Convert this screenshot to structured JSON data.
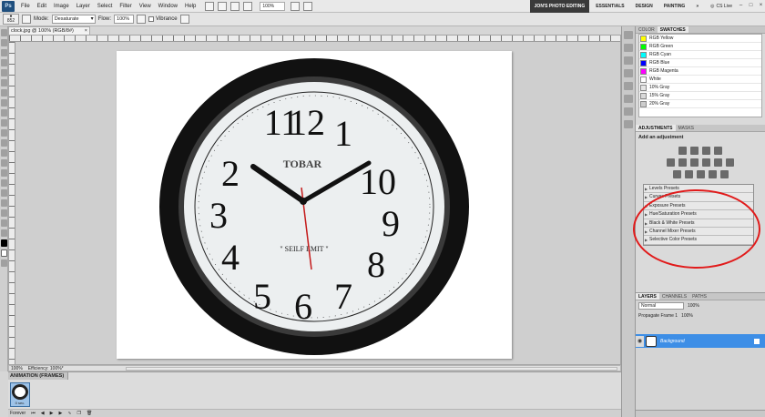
{
  "menubar": {
    "logo": "Ps",
    "items": [
      "File",
      "Edit",
      "Image",
      "Layer",
      "Select",
      "Filter",
      "View",
      "Window",
      "Help"
    ],
    "zoom": "100%",
    "workspaces": [
      "JON'S PHOTO EDITING",
      "ESSENTIALS",
      "DESIGN",
      "PAINTING"
    ],
    "active_workspace": "JON'S PHOTO EDITING",
    "more": "»",
    "cs_live": "CS Live",
    "window_controls": [
      "–",
      "□",
      "×"
    ]
  },
  "options": {
    "brush_size": "852",
    "mode_label": "Mode:",
    "mode_value": "Desaturate",
    "flow_label": "Flow:",
    "flow_value": "100%",
    "vibrance_label": "Vibrance"
  },
  "document": {
    "tab_title": "clock.jpg @ 100% (RGB/8#)",
    "close": "×",
    "zoom_status": "100%",
    "efficiency": "Efficiency: 100%*"
  },
  "clock": {
    "brand": "TOBAR",
    "tagline": "\" SEILF EMIT \"",
    "numbers": [
      "12",
      "1",
      "2",
      "3",
      "4",
      "5",
      "6",
      "7",
      "8",
      "9",
      "10",
      "11"
    ]
  },
  "animation": {
    "title": "ANIMATION (FRAMES)",
    "frame_delay": "0 sec.",
    "loop": "Forever"
  },
  "swatches": {
    "tabs": [
      "COLOR",
      "SWATCHES"
    ],
    "active_tab": "SWATCHES",
    "items": [
      {
        "name": "RGB Yellow",
        "color": "#ffff00"
      },
      {
        "name": "RGB Green",
        "color": "#00ff00"
      },
      {
        "name": "RGB Cyan",
        "color": "#00ffff"
      },
      {
        "name": "RGB Blue",
        "color": "#0000ff"
      },
      {
        "name": "RGB Magenta",
        "color": "#ff00ff"
      },
      {
        "name": "White",
        "color": "#ffffff"
      },
      {
        "name": "10% Gray",
        "color": "#e6e6e6"
      },
      {
        "name": "15% Gray",
        "color": "#d9d9d9"
      },
      {
        "name": "20% Gray",
        "color": "#cccccc"
      }
    ]
  },
  "adjustments": {
    "tabs": [
      "ADJUSTMENTS",
      "MASKS"
    ],
    "title": "Add an adjustment",
    "presets": [
      "Levels Presets",
      "Curves Presets",
      "Exposure Presets",
      "Hue/Saturation Presets",
      "Black & White Presets",
      "Channel Mixer Presets",
      "Selective Color Presets"
    ]
  },
  "layers": {
    "tabs": [
      "LAYERS",
      "CHANNELS",
      "PATHS"
    ],
    "blend_mode": "Normal",
    "opacity": "100%",
    "fill": "100%",
    "propagate": "Propagate Frame 1",
    "layer_name": "Background"
  },
  "colors": {
    "annotation_red": "#e11a1a",
    "selected_layer": "#3d8ee6",
    "canvas_bg": "#cfcfcf"
  }
}
